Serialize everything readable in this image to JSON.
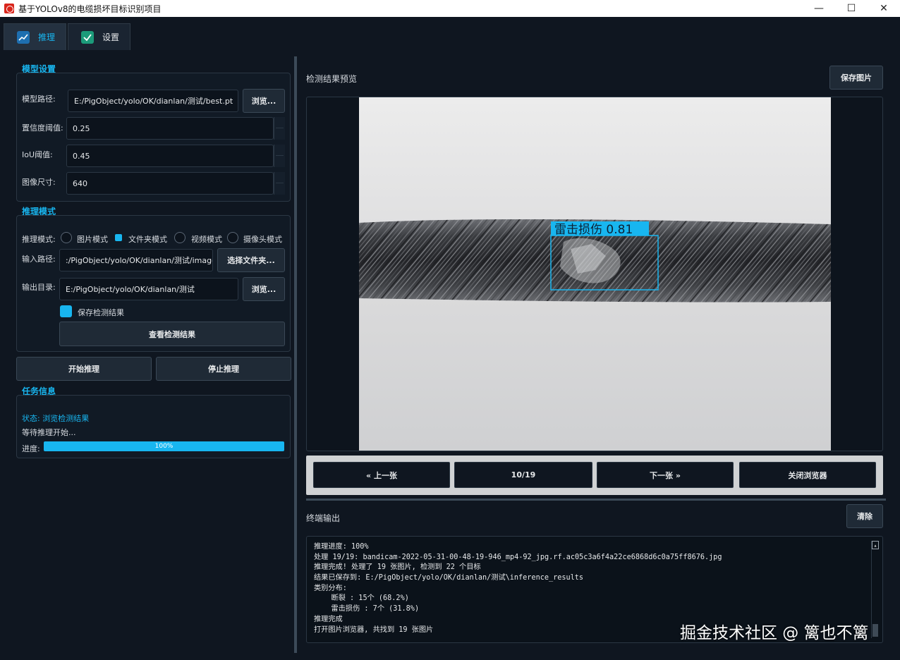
{
  "window": {
    "title": "基于YOLOv8的电缆损坏目标识别项目",
    "controls": {
      "minimize": "—",
      "maximize": "☐",
      "close": "✕"
    }
  },
  "tabs": [
    {
      "label": "推理",
      "icon": "chart-line-icon",
      "active": true
    },
    {
      "label": "设置",
      "icon": "check-shield-icon",
      "active": false
    }
  ],
  "model_settings": {
    "title": "模型设置",
    "model_path_label": "模型路径:",
    "model_path_value": "E:/PigObject/yolo/OK/dianlan/测试/best.pt",
    "browse_label": "浏览...",
    "conf_label": "置信度阈值:",
    "conf_value": "0.25",
    "iou_label": "IoU阈值:",
    "iou_value": "0.45",
    "imgsz_label": "图像尺寸:",
    "imgsz_value": "640"
  },
  "inference_mode": {
    "title": "推理模式",
    "mode_label": "推理模式:",
    "modes": [
      "图片模式",
      "文件夹模式",
      "视频模式",
      "摄像头模式"
    ],
    "selected_mode": "文件夹模式",
    "input_label": "输入路径:",
    "input_value": ":/PigObject/yolo/OK/dianlan/测试/image",
    "select_folder_label": "选择文件夹...",
    "output_label": "输出目录:",
    "output_value": "E:/PigObject/yolo/OK/dianlan/测试",
    "output_browse_label": "浏览...",
    "save_results_label": "保存检测结果",
    "save_results_checked": true,
    "view_results_label": "查看检测结果"
  },
  "actions": {
    "start_label": "开始推理",
    "stop_label": "停止推理"
  },
  "task_info": {
    "title": "任务信息",
    "status": "状态: 浏览检测结果",
    "waiting": "等待推理开始...",
    "progress_label": "进度:",
    "progress_text": "100%",
    "progress_value": 1.0
  },
  "preview": {
    "title": "检测结果预览",
    "save_image_label": "保存图片",
    "detection": {
      "class_name": "雷击损伤",
      "score": "0.81",
      "label_text": "雷击损伤  0.81",
      "box_color": "#18b6f0"
    }
  },
  "navigation": {
    "prev_label": "« 上一张",
    "counter": "10/19",
    "next_label": "下一张 »",
    "close_browser_label": "关闭浏览器"
  },
  "terminal": {
    "title": "终端输出",
    "clear_label": "清除",
    "lines": [
      "推理进度: 100%",
      "处理 19/19: bandicam-2022-05-31-00-48-19-946_mp4-92_jpg.rf.ac05c3a6f4a22ce6868d6c0a75ff8676.jpg",
      "推理完成! 处理了 19 张图片, 检测到 22 个目标",
      "结果已保存到: E:/PigObject/yolo/OK/dianlan/测试\\inference_results",
      "类别分布:",
      "    断裂 : 15个 (68.2%)",
      "    雷击损伤 : 7个 (31.8%)",
      "推理完成",
      "打开图片浏览器, 共找到 19 张图片"
    ]
  },
  "watermark": "掘金技术社区 @ 篱也不篱",
  "colors": {
    "accent": "#18b6f0",
    "background": "#0f1620"
  }
}
